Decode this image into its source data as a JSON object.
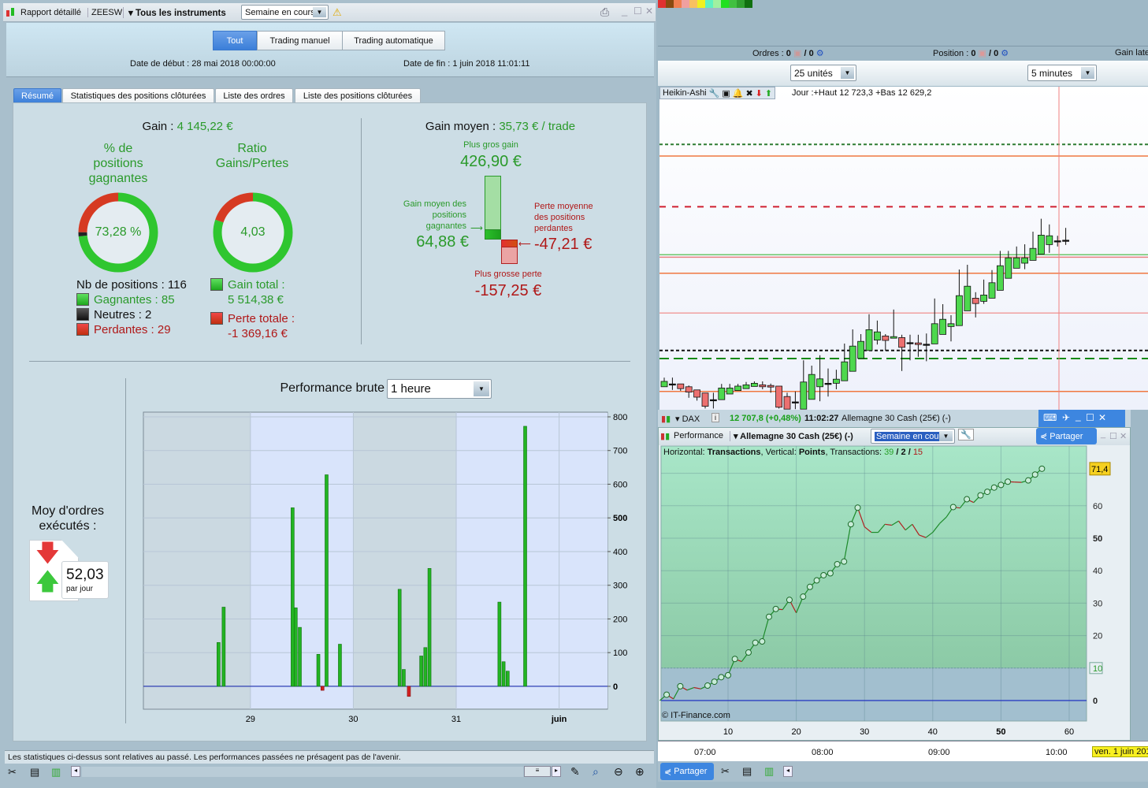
{
  "left_window": {
    "title": "Rapport détaillé",
    "account": "ZEESW",
    "instruments": "Tous les instruments",
    "period": "Semaine en cours",
    "mode_tabs": [
      "Tout",
      "Trading manuel",
      "Trading automatique"
    ],
    "start_date": "Date de début : 28 mai 2018 00:00:00",
    "end_date": "Date de fin : 1 juin 2018 11:01:11",
    "tabs": [
      "Résumé",
      "Statistiques des positions clôturées",
      "Liste des ordres",
      "Liste des positions clôturées"
    ],
    "summary": {
      "gain_label": "Gain :",
      "gain_value": "4 145,22 €",
      "win_pct_title": [
        "% de",
        "positions",
        "gagnantes"
      ],
      "win_pct_value": "73,28 %",
      "ratio_title": [
        "Ratio",
        "Gains/Pertes"
      ],
      "ratio_value": "4,03",
      "nb_positions": "Nb de positions : 116",
      "winners": "Gagnantes : 85",
      "neutral": "Neutres : 2",
      "losers": "Perdantes : 29",
      "gain_total_label": "Gain total :",
      "gain_total_value": "5 514,38 €",
      "loss_total_label": "Perte totale :",
      "loss_total_value": "-1 369,16 €",
      "positions": {
        "winners": 85,
        "neutral": 2,
        "losers": 29
      },
      "totals": {
        "gain": 5514.38,
        "loss": 1369.16
      },
      "avg_gain_label": "Gain moyen :",
      "avg_gain_value": "35,73 € / trade",
      "biggest_gain_label": "Plus gros gain",
      "biggest_gain_value": "426,90 €",
      "avg_win_label": [
        "Gain moyen des",
        "positions",
        "gagnantes"
      ],
      "avg_win_value": "64,88 €",
      "avg_loss_label": [
        "Perte moyenne",
        "des positions",
        "perdantes"
      ],
      "avg_loss_value": "-47,21 €",
      "biggest_loss_label": "Plus grosse perte",
      "biggest_loss_value": "-157,25 €"
    },
    "orders": {
      "title": [
        "Moy d'ordres",
        "exécutés :"
      ],
      "value": "52,03",
      "unit": "par jour"
    },
    "performance": {
      "label": "Performance brute",
      "interval": "1 heure"
    },
    "disclaimer": "Les statistiques ci-dessus sont relatives au passé. Les performances passées ne présagent pas de l'avenir."
  },
  "right": {
    "orders_label": "Ordres :",
    "orders_count": "0",
    "orders_total": "/ 0",
    "position_label": "Position :",
    "position_count": "0",
    "position_total": "/ 0",
    "gain_label": "Gain late",
    "units": "25 unités",
    "timeframe": "5 minutes",
    "chart_type": "Heikin-Ashi",
    "day_info": "Jour :+Haut 12 723,3 +Bas 12 629,2",
    "ticker": "DAX",
    "price": "12 707,8 (+0,48%)",
    "time": "11:02:27",
    "instrument": "Allemagne 30 Cash (25€) (-)",
    "perf_title": "Performance",
    "perf_instrument": "Allemagne 30 Cash (25€) (-)",
    "perf_period": "Semaine en cours",
    "share": "Partager",
    "perf_header": {
      "h": "Horizontal:",
      "h_val": "Transactions",
      "v": "Vertical:",
      "v_val": "Points",
      "t": "Transactions:",
      "wins": "39",
      "neutral": "2",
      "losses": "15",
      "sep": "/"
    },
    "copyright": "© IT-Finance.com",
    "last_value": "71,4",
    "time_labels": [
      "07:00",
      "08:00",
      "09:00",
      "10:00"
    ],
    "date_label": "ven. 1 juin 201"
  },
  "colors": {
    "win": "#22b422",
    "loss": "#d23a2a",
    "neutral": "#222",
    "accent": "#3b7fd9"
  },
  "chart_data": [
    {
      "type": "bar",
      "title": "Performance brute",
      "x_unit": "day of month (juin = 32)",
      "xlim": [
        27.96,
        32.47
      ],
      "ylim": [
        -68,
        814
      ],
      "x_ticks": [
        {
          "x": 29,
          "label": "29"
        },
        {
          "x": 30,
          "label": "30"
        },
        {
          "x": 31,
          "label": "31"
        },
        {
          "x": 32,
          "label": "juin"
        }
      ],
      "y_ticks": [
        0,
        100,
        200,
        300,
        400,
        500,
        600,
        700,
        800
      ],
      "x": [
        28.69,
        28.74,
        29.41,
        29.44,
        29.48,
        29.66,
        29.7,
        29.74,
        29.87,
        30.45,
        30.49,
        30.54,
        30.66,
        30.7,
        30.74,
        31.42,
        31.46,
        31.5,
        31.67
      ],
      "values": [
        130,
        235,
        530,
        233,
        175,
        95,
        -12,
        628,
        125,
        288,
        50,
        -30,
        90,
        115,
        350,
        250,
        73,
        45,
        772
      ]
    },
    {
      "type": "line",
      "xlabel": "Transactions",
      "ylabel": "Points",
      "xlim": [
        0,
        62
      ],
      "ylim": [
        -8,
        76
      ],
      "x_ticks": [
        10,
        20,
        30,
        40,
        50,
        60
      ],
      "y_ticks": [
        0,
        10,
        20,
        30,
        40,
        50,
        60
      ],
      "y": [
        0,
        1.8,
        0.5,
        4.4,
        3.2,
        4,
        3.6,
        4.6,
        5.8,
        7.2,
        7.8,
        12.8,
        12,
        14.8,
        17.8,
        18.2,
        25.8,
        28.2,
        28,
        31,
        27,
        32,
        35,
        37,
        38.6,
        39.2,
        42,
        42.8,
        54.3,
        59.4,
        53.5,
        51.8,
        51.8,
        54.3,
        54,
        55.3,
        52.5,
        54.3,
        51,
        50.2,
        51.8,
        54.5,
        56.5,
        59.6,
        59.3,
        62,
        61,
        63.2,
        64.3,
        65.6,
        66.4,
        67.4,
        67.3,
        67.2,
        67.8,
        69.6,
        71.4
      ]
    },
    {
      "type": "candlestick",
      "title": "DAX Heikin-Ashi 5 minutes",
      "ohlc": [
        [
          12669.8,
          12672.7,
          12669.8,
          12671.5
        ],
        [
          12670.7,
          12672.7,
          12668.8,
          12670.7
        ],
        [
          12670.7,
          12670.7,
          12668.5,
          12669.2
        ],
        [
          12669.8,
          12670.2,
          12666.3,
          12668.1
        ],
        [
          12668.8,
          12668.8,
          12665.4,
          12666.5
        ],
        [
          12667.8,
          12667.8,
          12662.9,
          12663.6
        ],
        [
          12665.7,
          12667.9,
          12662.9,
          12665.7
        ],
        [
          12665.7,
          12670.7,
          12665.7,
          12669.4
        ],
        [
          12667.5,
          12670.7,
          12667.5,
          12669.4
        ],
        [
          12668.6,
          12670.7,
          12668.6,
          12670
        ],
        [
          12669.2,
          12671.3,
          12669.2,
          12670.4
        ],
        [
          12669.9,
          12671.5,
          12669.9,
          12670.9
        ],
        [
          12670.4,
          12671.5,
          12669,
          12669.8
        ],
        [
          12670.2,
          12670.8,
          12667.9,
          12669.7
        ],
        [
          12670,
          12670,
          12662.9,
          12663.3
        ],
        [
          12666.7,
          12667.9,
          12662.7,
          12662.7
        ],
        [
          12665,
          12668.3,
          12662.7,
          12665
        ],
        [
          12662.7,
          12678.2,
          12662.7,
          12671.3
        ],
        [
          12665.8,
          12676.5,
          12665.8,
          12673.7
        ],
        [
          12669.8,
          12679.8,
          12665.2,
          12672.3
        ],
        [
          12670.9,
          12675.6,
          12666.7,
          12670.9
        ],
        [
          12670.9,
          12675.2,
          12669,
          12672.2
        ],
        [
          12671.7,
          12683.5,
          12671.7,
          12677.7
        ],
        [
          12674.7,
          12688,
          12674.7,
          12682.7
        ],
        [
          12678.8,
          12686.5,
          12678.8,
          12684.2
        ],
        [
          12681.3,
          12692.8,
          12681.3,
          12687.9
        ],
        [
          12684.6,
          12690.8,
          12683.2,
          12687.2
        ],
        [
          12685.9,
          12686.5,
          12681.2,
          12684.5
        ],
        [
          12685.2,
          12694.3,
          12685.2,
          12685.7
        ],
        [
          12685.4,
          12686.3,
          12674.8,
          12682.3
        ],
        [
          12683.8,
          12686.3,
          12678.2,
          12683.8
        ],
        [
          12683.7,
          12686.3,
          12679.3,
          12683.2
        ],
        [
          12683.3,
          12686.7,
          12677.9,
          12683.3
        ],
        [
          12683.4,
          12697.8,
          12683.4,
          12689.8
        ],
        [
          12686.4,
          12696,
          12686.4,
          12691.2
        ],
        [
          12688.9,
          12692.5,
          12684.2,
          12689.8
        ],
        [
          12689.2,
          12707,
          12689.2,
          12698.7
        ],
        [
          12693.9,
          12708.5,
          12693.9,
          12701.7
        ],
        [
          12697.9,
          12699.8,
          12691.8,
          12696.2
        ],
        [
          12696.9,
          12703.8,
          12696.1,
          12698.9
        ],
        [
          12697.9,
          12706.8,
          12697.9,
          12702.8
        ],
        [
          12700.4,
          12712.9,
          12700.4,
          12708.2
        ],
        [
          12704.2,
          12712.9,
          12704.2,
          12710.7
        ],
        [
          12707.4,
          12714.3,
          12707.4,
          12710.7
        ],
        [
          12709,
          12715,
          12707.1,
          12710.7
        ],
        [
          12709.9,
          12719,
          12709.9,
          12713.7
        ],
        [
          12711.9,
          12723.1,
          12711.9,
          12717.9
        ],
        [
          12714.9,
          12721.3,
          12712.3,
          12717.7
        ],
        [
          12716.1,
          12717.7,
          12714.3,
          12716.1
        ],
        [
          12716.3,
          12720.2,
          12714.8,
          12716.3
        ]
      ],
      "levels": [
        {
          "price": 12746.7,
          "color": "#2e7d32",
          "style": "dotted"
        },
        {
          "price": 12743,
          "color": "#f07840",
          "style": "solid"
        },
        {
          "price": 12726.9,
          "color": "#d02030",
          "style": "dashed"
        },
        {
          "price": 12711.7,
          "color": "#6cc66c",
          "style": "solid"
        },
        {
          "price": 12710.9,
          "color": "#e88080",
          "style": "solid"
        },
        {
          "price": 12705.8,
          "color": "#f07840",
          "style": "solid"
        },
        {
          "price": 12693.2,
          "color": "#f0a0a0",
          "style": "solid"
        },
        {
          "price": 12681.3,
          "color": "#111111",
          "style": "dotted"
        },
        {
          "price": 12678.75,
          "color": "#138a13",
          "style": "dashed"
        },
        {
          "price": 12668.3,
          "color": "#f07840",
          "style": "solid"
        }
      ]
    }
  ]
}
